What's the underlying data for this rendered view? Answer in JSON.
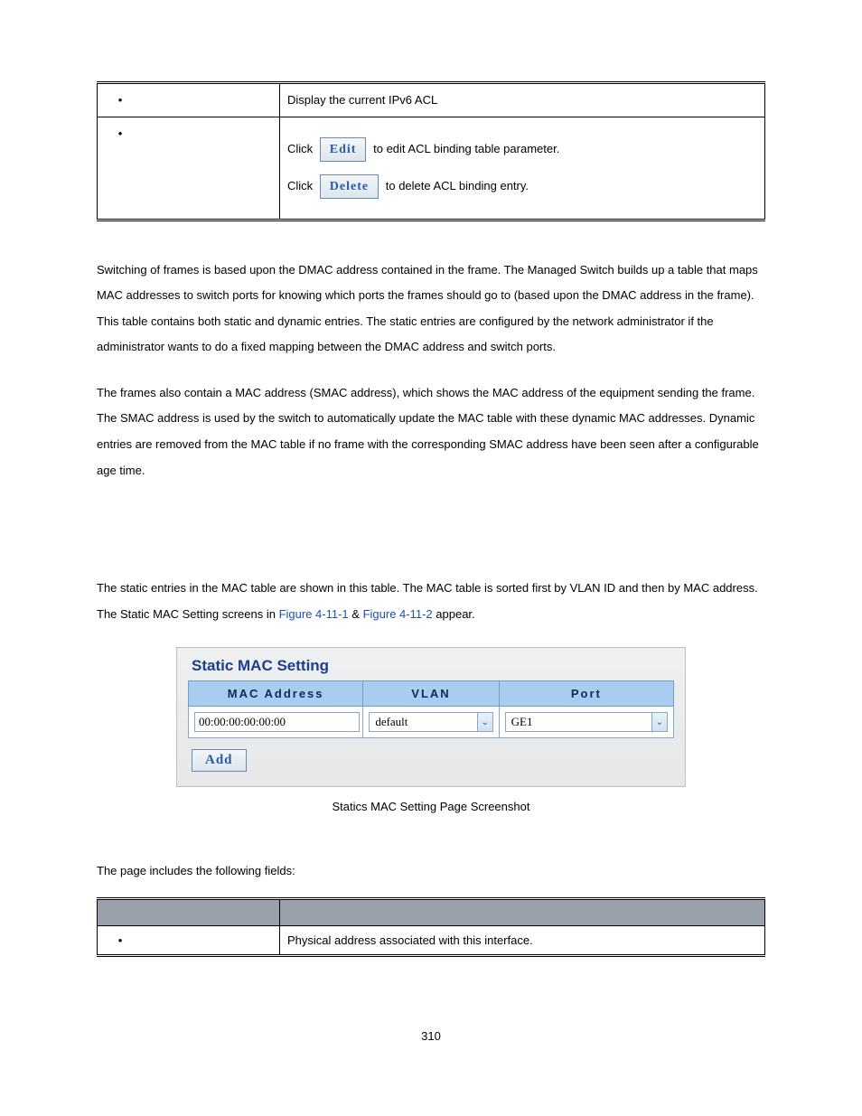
{
  "desc_table": {
    "row1_right": "Display the current IPv6 ACL",
    "row2": {
      "click1": "Click",
      "edit_btn": "Edit",
      "after_edit": " to edit ACL binding table parameter.",
      "click2": "Click",
      "delete_btn": "Delete",
      "after_delete": " to delete ACL binding entry."
    }
  },
  "para1": "Switching of frames is based upon the DMAC address contained in the frame. The Managed Switch builds up a table that maps MAC addresses to switch ports for knowing which ports the frames should go to (based upon the DMAC address in the frame). This table contains both static and dynamic entries. The static entries are configured by the network administrator if the administrator wants to do a fixed mapping between the DMAC address and switch ports.",
  "para2": "The frames also contain a MAC address (SMAC address), which shows the MAC address of the equipment sending the frame. The SMAC address is used by the switch to automatically update the MAC table with these dynamic MAC addresses. Dynamic entries are removed from the MAC table if no frame with the corresponding SMAC address have been seen after a configurable age time.",
  "para3_a": "The static entries in the MAC table are shown in this table. The MAC table is sorted first by VLAN ID and then by MAC address. The Static MAC Setting screens in ",
  "fig1": "Figure 4-11-1",
  "amp": " & ",
  "fig2": "Figure 4-11-2",
  "para3_b": " appear.",
  "ui": {
    "title": "Static MAC Setting",
    "headers": {
      "mac": "MAC Address",
      "vlan": "VLAN",
      "port": "Port"
    },
    "values": {
      "mac": "00:00:00:00:00:00",
      "vlan": "default",
      "port": "GE1"
    },
    "add_btn": "Add"
  },
  "caption": "Statics MAC Setting Page Screenshot",
  "fields_intro": "The page includes the following fields:",
  "fields_row1_right": "Physical address associated with this interface.",
  "page_num": "310"
}
